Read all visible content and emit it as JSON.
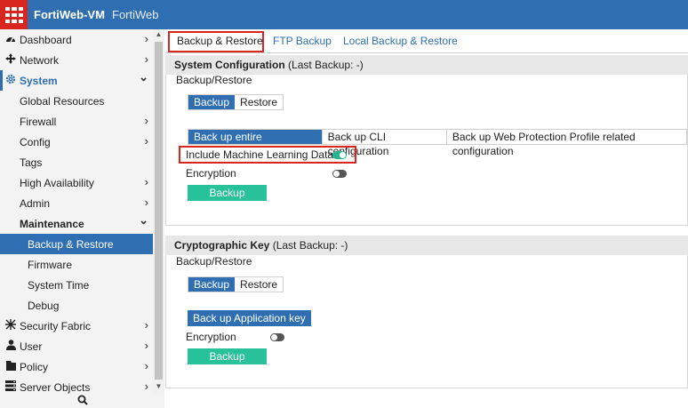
{
  "header": {
    "app_name": "FortiWeb-VM",
    "product": "FortiWeb",
    "brand_color": "#2f6fb1",
    "logo_color": "#d8261f"
  },
  "sidebar": {
    "items": [
      {
        "label": "Dashboard",
        "icon": "dashboard-icon",
        "chevron": "›"
      },
      {
        "label": "Network",
        "icon": "network-icon",
        "chevron": "›"
      },
      {
        "label": "System",
        "icon": "gear-icon",
        "chevron": "⌄"
      },
      {
        "label": "Global Resources"
      },
      {
        "label": "Firewall",
        "chevron": "›"
      },
      {
        "label": "Config",
        "chevron": "›"
      },
      {
        "label": "Tags"
      },
      {
        "label": "High Availability",
        "chevron": "›"
      },
      {
        "label": "Admin",
        "chevron": "›"
      },
      {
        "label": "Maintenance",
        "chevron": "⌄"
      },
      {
        "label": "Backup & Restore"
      },
      {
        "label": "Firmware"
      },
      {
        "label": "System Time"
      },
      {
        "label": "Debug"
      },
      {
        "label": "Security Fabric",
        "icon": "security-fabric-icon",
        "chevron": "›"
      },
      {
        "label": "User",
        "icon": "user-icon",
        "chevron": "›"
      },
      {
        "label": "Policy",
        "icon": "policy-icon",
        "chevron": "›"
      },
      {
        "label": "Server Objects",
        "icon": "server-icon",
        "chevron": "›"
      }
    ]
  },
  "tabs": [
    {
      "label": "Backup & Restore"
    },
    {
      "label": "FTP Backup"
    },
    {
      "label": "Local Backup & Restore"
    }
  ],
  "system_config": {
    "title": "System Configuration",
    "last_backup": "(Last Backup: -)",
    "group_label": "Backup/Restore",
    "mode_backup": "Backup",
    "mode_restore": "Restore",
    "scope_entire": "Back up entire configuration",
    "scope_cli": "Back up CLI configuration",
    "scope_wpp": "Back up Web Protection Profile related configuration",
    "include_ml_label": "Include Machine Learning Data",
    "include_ml_on": true,
    "encryption_label": "Encryption",
    "encryption_on": false,
    "backup_button": "Backup"
  },
  "crypto_key": {
    "title": "Cryptographic Key",
    "last_backup": "(Last Backup: -)",
    "group_label": "Backup/Restore",
    "mode_backup": "Backup",
    "mode_restore": "Restore",
    "app_key_button": "Back up Application key",
    "encryption_label": "Encryption",
    "encryption_on": false,
    "backup_button": "Backup"
  },
  "colors": {
    "accent_green": "#27c29a",
    "highlight_red": "#d8261f",
    "toggle_on": "#27b590"
  }
}
